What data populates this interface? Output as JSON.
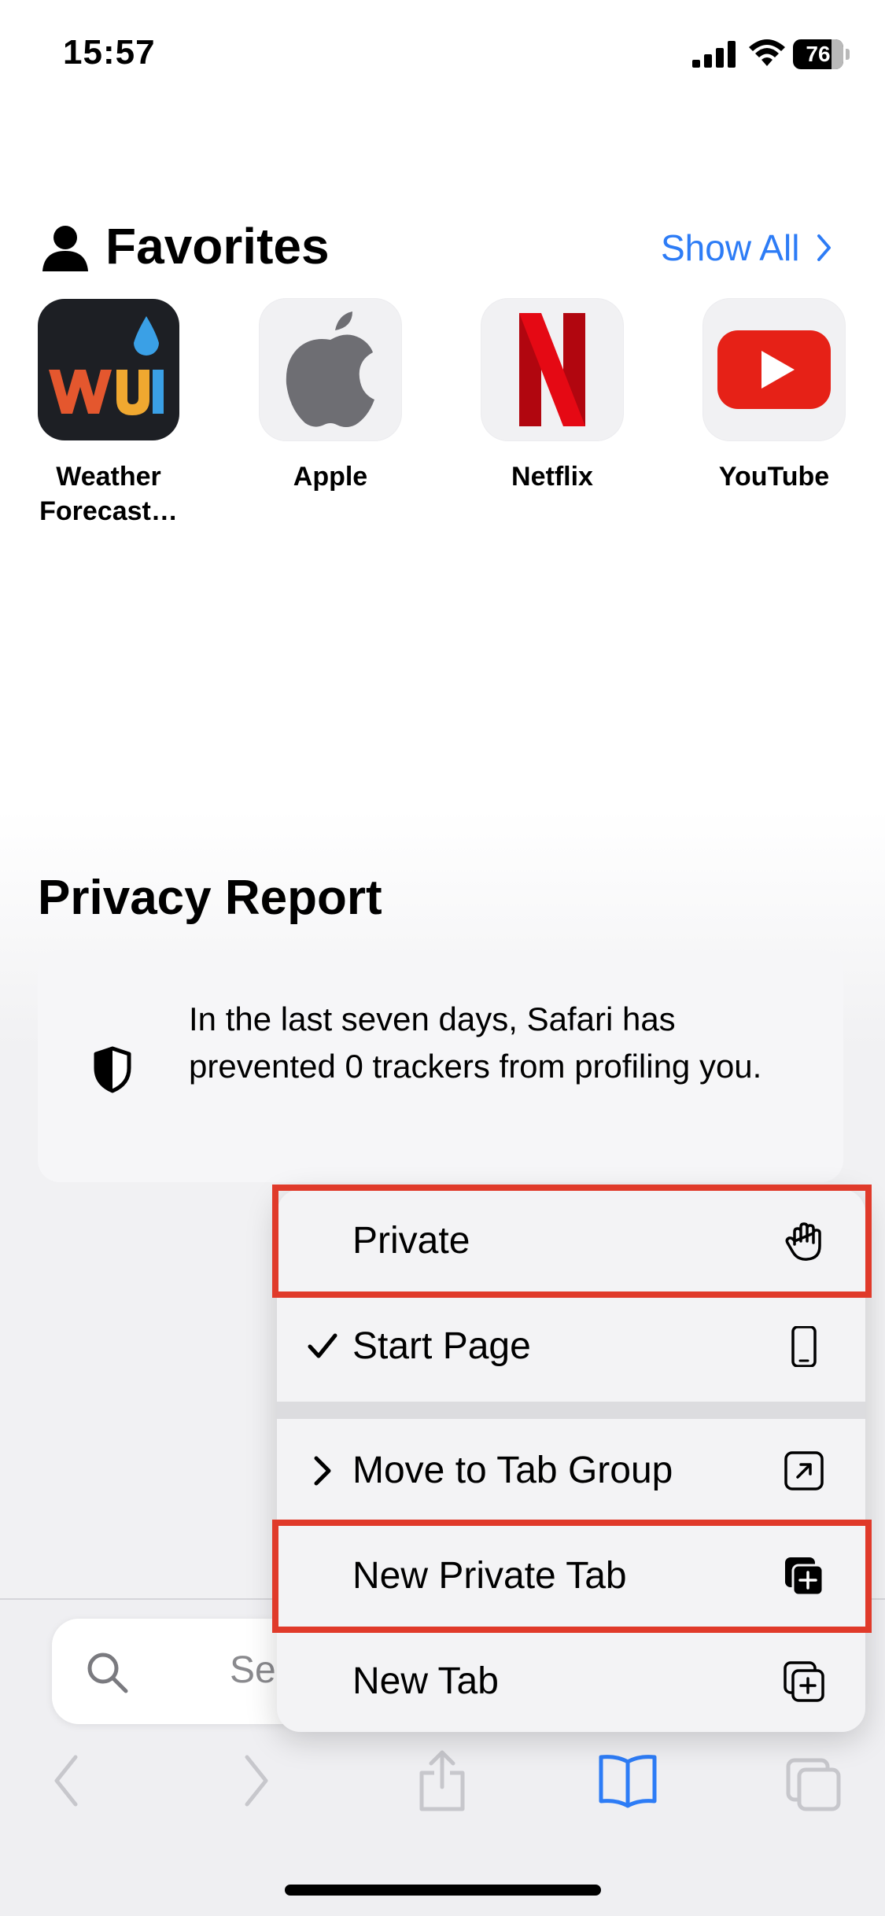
{
  "status_bar": {
    "time": "15:57",
    "battery": "76",
    "battery_level": 0.76
  },
  "favorites": {
    "title": "Favorites",
    "show_all": "Show All",
    "items": [
      {
        "label": "Weather Forecast…",
        "icon": "weather-underground-icon"
      },
      {
        "label": "Apple",
        "icon": "apple-logo-icon"
      },
      {
        "label": "Netflix",
        "icon": "netflix-logo-icon"
      },
      {
        "label": "YouTube",
        "icon": "youtube-logo-icon"
      }
    ]
  },
  "privacy": {
    "title": "Privacy Report",
    "text": "In the last seven days, Safari has prevented 0 trackers from profiling you."
  },
  "search": {
    "placeholder": "Se"
  },
  "menu": {
    "items": [
      {
        "label": "Private",
        "icon": "hand-raised-icon",
        "highlighted": true
      },
      {
        "label": "Start Page",
        "icon": "iphone-icon",
        "checked": true
      },
      {
        "label": "Move to Tab Group",
        "icon": "arrow-up-right-square-icon",
        "submenu": true
      },
      {
        "label": "New Private Tab",
        "icon": "plus-square-on-square-filled-icon",
        "highlighted": true
      },
      {
        "label": "New Tab",
        "icon": "plus-square-on-square-icon"
      }
    ]
  },
  "colors": {
    "accent": "#2d7cf6",
    "highlight": "#e03a2a",
    "disabled_icon": "#c7c7cc"
  }
}
